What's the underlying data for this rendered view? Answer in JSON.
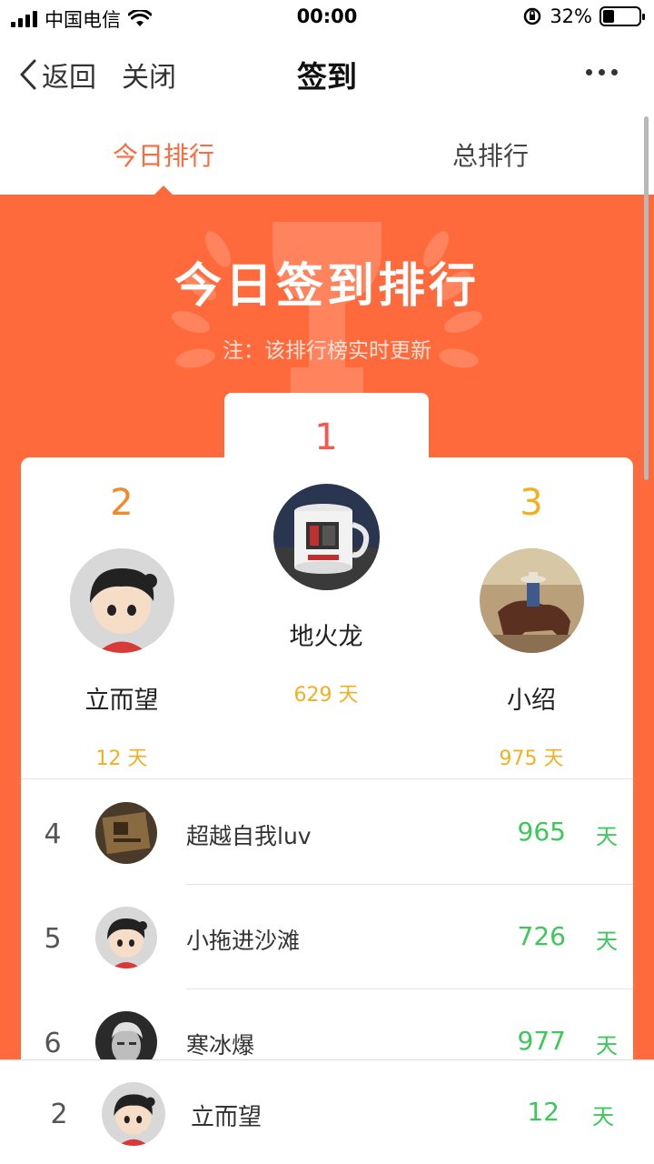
{
  "status_bar": {
    "carrier": "中国电信",
    "time": "00:00",
    "battery": "32%"
  },
  "nav": {
    "back_label": "返回",
    "close_label": "关闭",
    "title": "签到"
  },
  "tabs": [
    {
      "label": "今日排行",
      "active": true
    },
    {
      "label": "总排行",
      "active": false
    }
  ],
  "banner": {
    "title": "今日签到排行",
    "note": "注：该排行榜实时更新"
  },
  "podium": {
    "first": {
      "rank": "1",
      "name": "地火龙",
      "days": "629 天"
    },
    "second": {
      "rank": "2",
      "name": "立而望",
      "days": "12 天"
    },
    "third": {
      "rank": "3",
      "name": "小绍",
      "days": "975 天"
    }
  },
  "list": [
    {
      "rank": "4",
      "name": "超越自我luv",
      "days": "965",
      "unit": "天"
    },
    {
      "rank": "5",
      "name": "小拖进沙滩",
      "days": "726",
      "unit": "天"
    },
    {
      "rank": "6",
      "name": "寒冰爆",
      "days": "977",
      "unit": "天"
    }
  ],
  "my_rank": {
    "rank": "2",
    "name": "立而望",
    "days": "12",
    "unit": "天"
  },
  "colors": {
    "accent": "#ff6a3d",
    "green": "#3cc85a",
    "gold": "#f0b020",
    "silver_rank": "#f08a2a",
    "first_rank": "#f05a50"
  }
}
